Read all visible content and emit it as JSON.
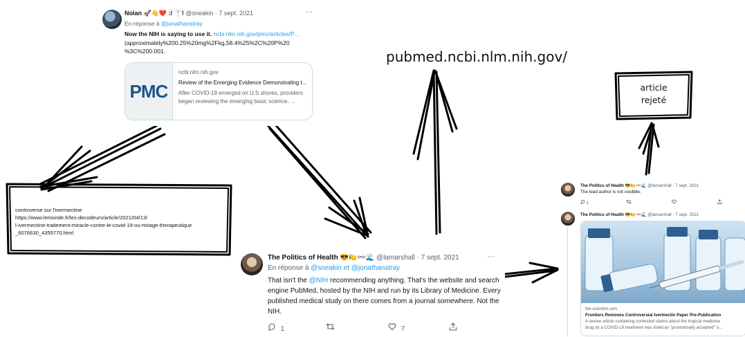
{
  "tweet_nolan": {
    "name": "Nolan 🚀👋❤️ :/ 🍸!",
    "handle_time": "@sneakin · 7 sept. 2021",
    "reply_prefix": "En réponse à",
    "reply_to": "@jonathanstray",
    "text_bold": "Now the NIH is saying to use it.",
    "text_link": "ncbi.nlm.nih.gov/pmc/articles/P…",
    "text_line2": "(approximately%200.25%20mg%2Fkg,58.4%25%2C%20P%20",
    "text_line3": "%3C%200.001.",
    "more": "···",
    "card": {
      "logo": "PMC",
      "domain": "ncbi.nlm.nih.gov",
      "title": "Review of the Emerging Evidence Demonstrating t...",
      "desc1": "After COVID-19 emerged on U.S shores, providers",
      "desc2": "began reviewing the emerging basic science, ..."
    }
  },
  "annotation_pubmed": "pubmed.ncbi.nlm.nih.gov/",
  "annotation_rejected": {
    "line1": "article",
    "line2": "rejeté"
  },
  "annotation_controversy": {
    "line1": "controverse sur l'ivermectine",
    "line2": "https://www.lemonde.fr/les-decodeurs/article/2021/04/13/",
    "line3": "l-ivermectine-traitement-miracle-contre-le-covid-19-ou-mirage-therapeutique",
    "line4": "_6076630_4355770.html"
  },
  "tweet_politics_main": {
    "name": "The Politics of Health 😎🍋👓🌊",
    "handle_time": "@lamarshall · 7 sept. 2021",
    "more": "···",
    "reply_prefix": "En réponse à",
    "reply_to_1": "@sneakin",
    "reply_and": "et",
    "reply_to_2": "@jonathanstray",
    "text_a": "That isn't the",
    "text_mention": "@NIH",
    "text_b": "recommending anything. That's the website and search",
    "text_line2": "engine PubMed, hosted by the NIH and run by its Library of Medicine. Every",
    "text_line3": "published medical study on there comes from a journal somewhere. Not the",
    "text_line4": "NIH.",
    "reply_count": "1",
    "like_count": "7"
  },
  "tweet_politics_small1": {
    "name": "The Politics of Health 😎🍋👓🌊",
    "handle_time": "@lamarshall · 7 sept. 2021",
    "text": "The lead author is not credible.",
    "reply_count": "1"
  },
  "tweet_politics_small2": {
    "name": "The Politics of Health 😎🍋👓🌊",
    "handle_time": "@lamarshall · 7 sept. 2021",
    "card": {
      "domain": "the-scientist.com",
      "title": "Frontiers Removes Controversial Ivermectin Paper Pre-Publication",
      "desc1": "A review article containing contested claims about the tropical medicine",
      "desc2": "drug as a COVID-19 treatment was listed as \"provisionally accepted\" o..."
    }
  },
  "colors": {
    "link": "#1d9bf0",
    "muted": "#536471",
    "ink": "#000000",
    "pmc_blue": "#20558a"
  }
}
